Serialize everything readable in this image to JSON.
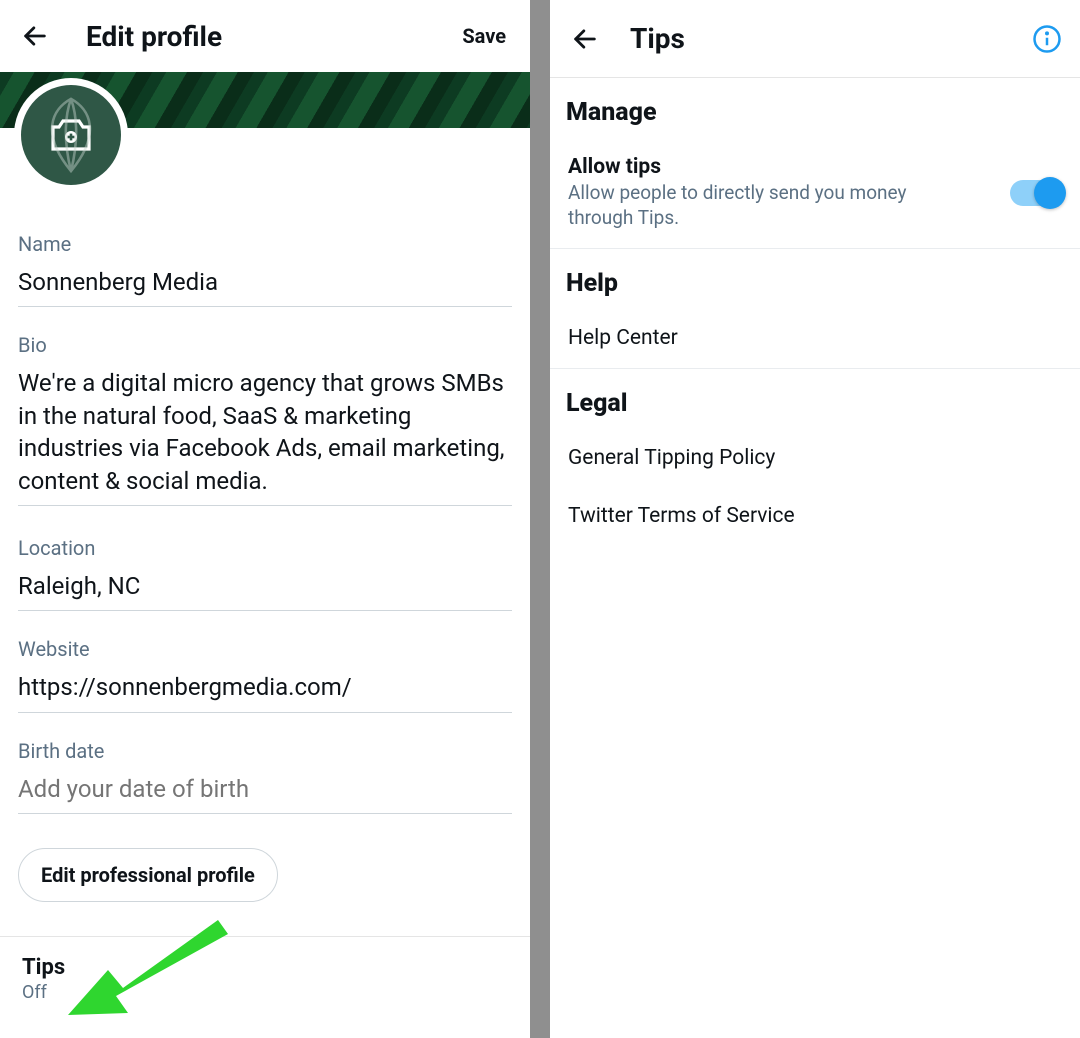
{
  "left": {
    "title": "Edit profile",
    "save_label": "Save",
    "fields": {
      "name": {
        "label": "Name",
        "value": "Sonnenberg Media"
      },
      "bio": {
        "label": "Bio",
        "value": "We're a digital micro agency that grows SMBs in the natural food, SaaS & marketing industries via Facebook Ads, email marketing, content & social media."
      },
      "location": {
        "label": "Location",
        "value": "Raleigh, NC"
      },
      "website": {
        "label": "Website",
        "value": "https://sonnenbergmedia.com/"
      },
      "birth": {
        "label": "Birth date",
        "placeholder": "Add your date of birth"
      }
    },
    "edit_pro_label": "Edit professional profile",
    "tips": {
      "title": "Tips",
      "status": "Off"
    }
  },
  "right": {
    "title": "Tips",
    "sections": {
      "manage": {
        "heading": "Manage",
        "allow": {
          "title": "Allow tips",
          "desc": "Allow people to directly send you money through Tips.",
          "on": true
        }
      },
      "help": {
        "heading": "Help",
        "items": [
          "Help Center"
        ]
      },
      "legal": {
        "heading": "Legal",
        "items": [
          "General Tipping Policy",
          "Twitter Terms of Service"
        ]
      }
    }
  },
  "colors": {
    "accent": "#1d9bf0",
    "arrow": "#2fd62f"
  }
}
